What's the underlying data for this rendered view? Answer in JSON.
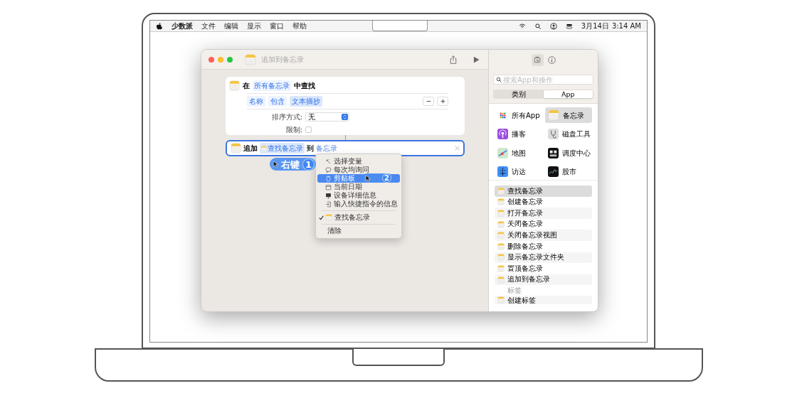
{
  "menubar": {
    "items": [
      "少数派",
      "文件",
      "编辑",
      "显示",
      "窗口",
      "帮助"
    ],
    "date": "3月14日",
    "time": "3:14 AM"
  },
  "window": {
    "title": "追加到备忘录"
  },
  "find_action": {
    "prefix": "在",
    "source": "所有备忘录",
    "suffix": "中查找",
    "filter": [
      "名称",
      "包含",
      "文本摘抄"
    ],
    "sort_label": "排序方式:",
    "sort_value": "无",
    "limit_label": "限制:",
    "limit_checked": false
  },
  "append_action": {
    "prefix": "追加",
    "token": "查找备忘录",
    "middle": "到",
    "target": "备忘录",
    "selected": true
  },
  "context_menu": {
    "items": [
      {
        "kind": "item",
        "label": "选择变量",
        "selected": false,
        "checked": false
      },
      {
        "kind": "item",
        "label": "每次均询问",
        "selected": false,
        "checked": false
      },
      {
        "kind": "item",
        "label": "剪贴板",
        "selected": true,
        "checked": false
      },
      {
        "kind": "item",
        "label": "当前日期",
        "selected": false,
        "checked": false
      },
      {
        "kind": "item",
        "label": "设备详细信息",
        "selected": false,
        "checked": false
      },
      {
        "kind": "item",
        "label": "输入快捷指令的信息",
        "selected": false,
        "checked": false
      },
      {
        "kind": "separator"
      },
      {
        "kind": "item",
        "label": "查找备忘录",
        "selected": false,
        "checked": true
      },
      {
        "kind": "separator"
      },
      {
        "kind": "item",
        "label": "清除",
        "selected": false,
        "checked": false
      }
    ]
  },
  "annotations": [
    {
      "number": "1",
      "label": "右键"
    },
    {
      "number": "2"
    }
  ],
  "sidebar": {
    "search": {
      "placeholder": "搜索App和操作"
    },
    "tabs": [
      {
        "label": "类别",
        "selected": false
      },
      {
        "label": "App",
        "selected": true
      }
    ],
    "apps": [
      {
        "label": "所有App",
        "selected": false
      },
      {
        "label": "备忘录",
        "selected": true
      },
      {
        "label": "播客",
        "selected": false
      },
      {
        "label": "磁盘工具",
        "selected": false
      },
      {
        "label": "地图",
        "selected": false
      },
      {
        "label": "调度中心",
        "selected": false
      },
      {
        "label": "访达",
        "selected": false
      },
      {
        "label": "股市",
        "selected": false
      }
    ],
    "actions": [
      {
        "label": "查找备忘录",
        "selected": true
      },
      {
        "label": "创建备忘录",
        "selected": false
      },
      {
        "label": "打开备忘录",
        "selected": false
      },
      {
        "label": "关闭备忘录",
        "selected": false
      },
      {
        "label": "关闭备忘录视图",
        "selected": false
      },
      {
        "label": "删除备忘录",
        "selected": false
      },
      {
        "label": "显示备忘录文件夹",
        "selected": false
      },
      {
        "label": "置顶备忘录",
        "selected": false
      },
      {
        "label": "追加到备忘录",
        "selected": false
      }
    ],
    "section": "标签",
    "section_items": [
      "创建标签"
    ]
  }
}
